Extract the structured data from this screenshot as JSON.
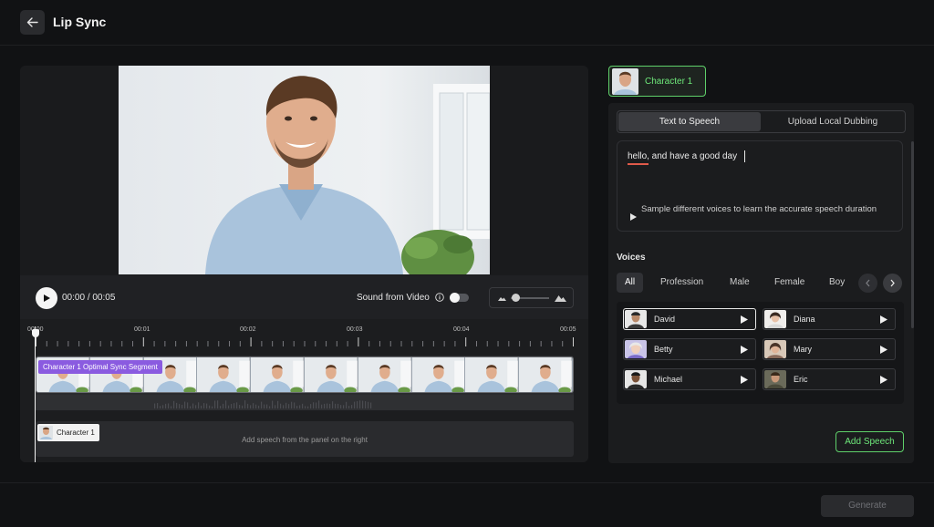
{
  "header": {
    "title": "Lip Sync"
  },
  "player": {
    "current_time": "00:00",
    "separator": "/",
    "duration": "00:05",
    "sound_label": "Sound from Video"
  },
  "timeline": {
    "tick_labels": [
      "00:00",
      "00:01",
      "00:02",
      "00:03",
      "00:04",
      "00:05"
    ],
    "segment_label": "Character 1 Optimal Sync Segment",
    "speech_chip_label": "Character 1",
    "speech_hint": "Add speech from the panel on the right"
  },
  "character_tab": {
    "label": "Character 1"
  },
  "mode_tabs": [
    {
      "label": "Text to Speech",
      "active": true
    },
    {
      "label": "Upload Local Dubbing",
      "active": false
    }
  ],
  "speech_text": {
    "value": "hello, and have a good day",
    "sample_hint": "Sample different voices to learn the accurate speech duration"
  },
  "voices": {
    "title": "Voices",
    "filters": [
      "All",
      "Profession",
      "Male",
      "Female",
      "Boy"
    ],
    "active_filter": "All",
    "items": [
      {
        "name": "David",
        "selected": true
      },
      {
        "name": "Diana",
        "selected": false
      },
      {
        "name": "Betty",
        "selected": false
      },
      {
        "name": "Mary",
        "selected": false
      },
      {
        "name": "Michael",
        "selected": false
      },
      {
        "name": "Eric",
        "selected": false
      }
    ]
  },
  "actions": {
    "add_speech": "Add Speech",
    "generate": "Generate"
  },
  "colors": {
    "accent_green": "#6ee87a",
    "segment_purple": "#8a5be0",
    "underline_red": "#e05a4a"
  }
}
